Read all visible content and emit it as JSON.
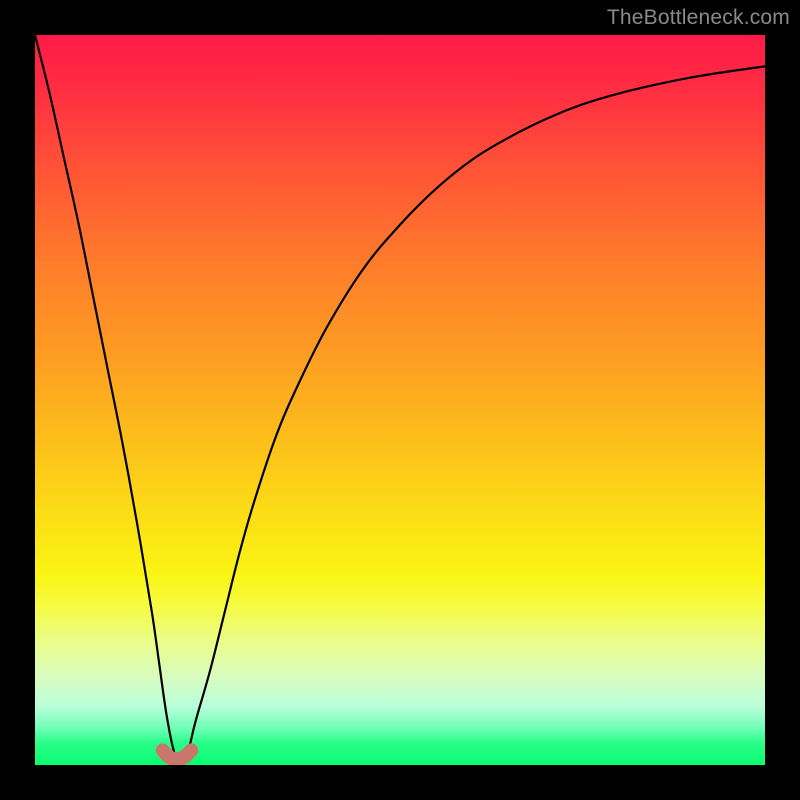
{
  "watermark": "TheBottleneck.com",
  "chart_data": {
    "type": "line",
    "title": "",
    "xlabel": "",
    "ylabel": "",
    "xlim": [
      0,
      100
    ],
    "ylim": [
      0,
      100
    ],
    "grid": false,
    "legend": false,
    "series": [
      {
        "name": "bottleneck-curve",
        "x": [
          0,
          2,
          4,
          6,
          8,
          10,
          12,
          14,
          16,
          17,
          18,
          19,
          20,
          21,
          22,
          24,
          26,
          28,
          30,
          33,
          36,
          40,
          45,
          50,
          55,
          60,
          65,
          70,
          75,
          80,
          85,
          90,
          95,
          100
        ],
        "values": [
          100,
          92,
          83,
          74,
          64,
          54,
          44,
          33,
          21,
          14,
          7,
          2,
          0,
          2,
          6,
          13,
          21,
          29,
          36,
          45,
          52,
          60,
          68,
          74,
          79,
          83,
          86,
          88.5,
          90.5,
          92,
          93.2,
          94.2,
          95,
          95.7
        ]
      }
    ],
    "markers": {
      "name": "valley-nub",
      "color": "#c9766c",
      "points": [
        {
          "x": 17.5,
          "y": 2.0
        },
        {
          "x": 18.2,
          "y": 1.2
        },
        {
          "x": 19.0,
          "y": 0.8
        },
        {
          "x": 19.8,
          "y": 0.8
        },
        {
          "x": 20.6,
          "y": 1.2
        },
        {
          "x": 21.4,
          "y": 2.0
        }
      ]
    },
    "background": {
      "type": "vertical-gradient",
      "stops": [
        {
          "pos": 0.0,
          "color": "#ff1a47"
        },
        {
          "pos": 0.32,
          "color": "#fe7e2a"
        },
        {
          "pos": 0.58,
          "color": "#fcc619"
        },
        {
          "pos": 0.74,
          "color": "#faf514"
        },
        {
          "pos": 0.88,
          "color": "#d8fcc0"
        },
        {
          "pos": 1.0,
          "color": "#09fd70"
        }
      ]
    }
  }
}
